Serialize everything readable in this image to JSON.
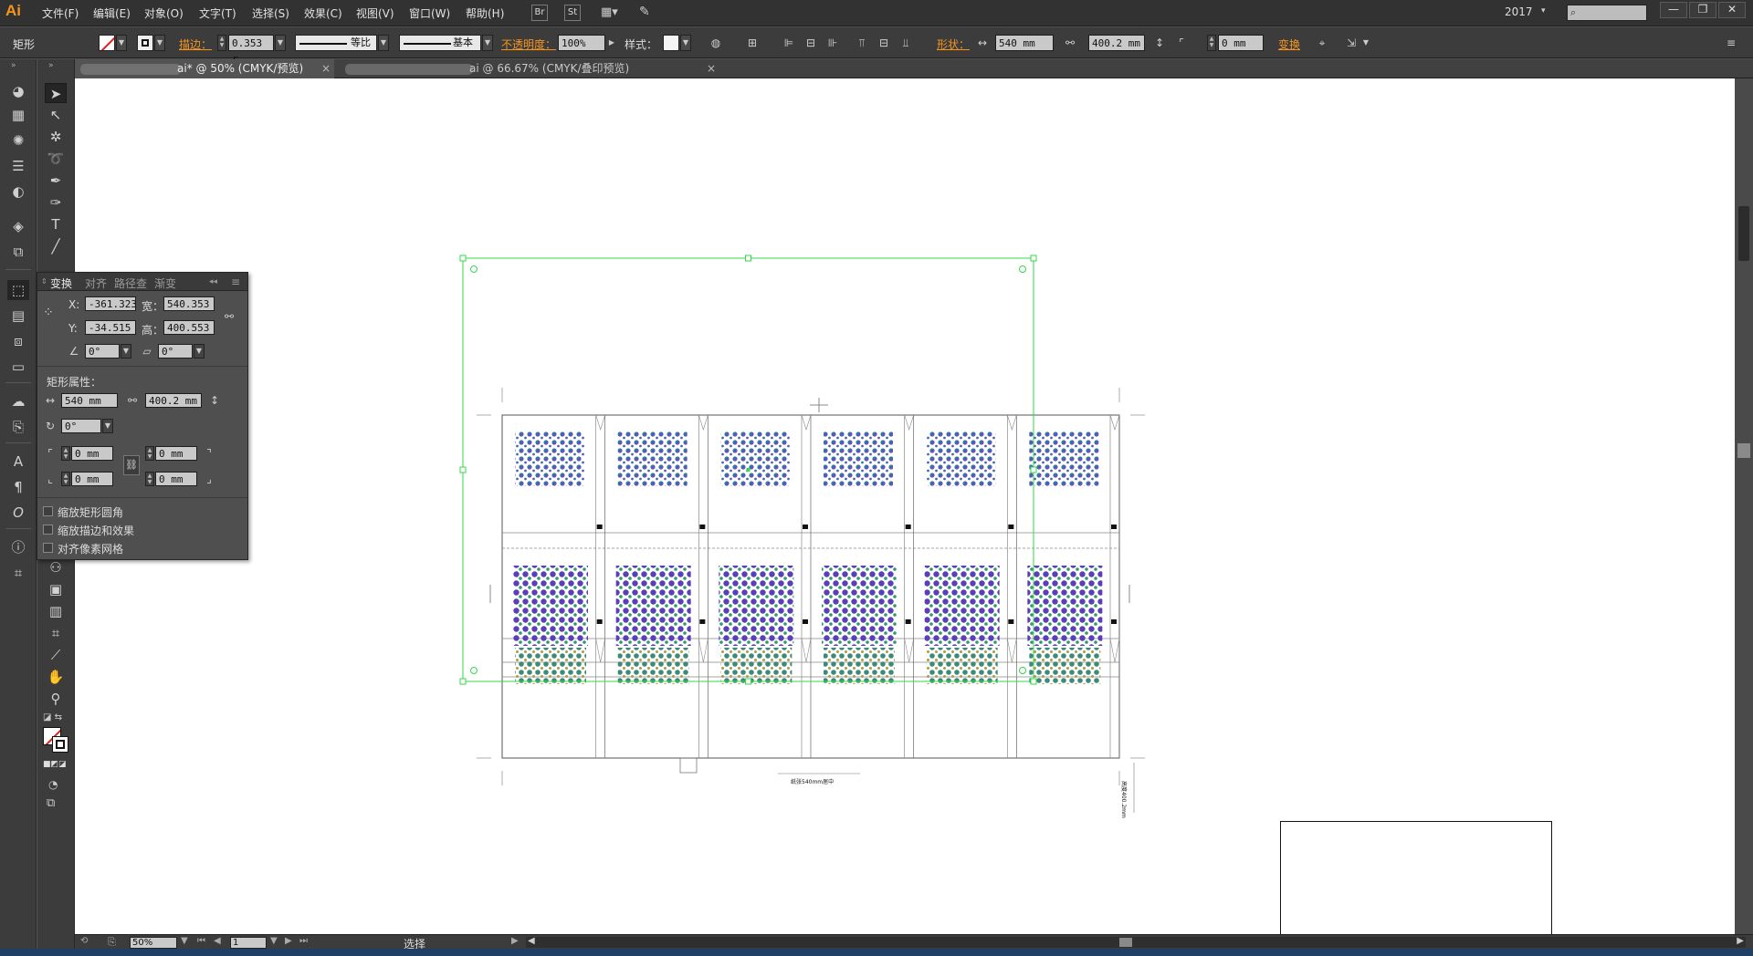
{
  "app": {
    "logo": "Ai",
    "year": "2017"
  },
  "menu": [
    "文件(F)",
    "编辑(E)",
    "对象(O)",
    "文字(T)",
    "选择(S)",
    "效果(C)",
    "视图(V)",
    "窗口(W)",
    "帮助(H)"
  ],
  "menu_buttons": [
    "Br",
    "St"
  ],
  "window_controls": [
    "—",
    "❐",
    "✕"
  ],
  "control_bar": {
    "object_type": "矩形",
    "stroke_label": "描边：",
    "stroke_value": "0.353 r",
    "stroke_profile": "等比",
    "brush": "基本",
    "opacity_label": "不透明度：",
    "opacity_value": "100%",
    "style_label": "样式：",
    "shape_label": "形状：",
    "width": "540 mm",
    "height": "400.2 mm",
    "corner": "0 mm",
    "transform_label": "变换"
  },
  "tabs": [
    {
      "label": "ai* @ 50% (CMYK/预览)",
      "active": true
    },
    {
      "label": "ai @ 66.67% (CMYK/叠印预览)",
      "active": false
    }
  ],
  "transform_panel": {
    "tabs": [
      "变换",
      "对齐",
      "路径查",
      "渐变"
    ],
    "x_label": "X:",
    "x_value": "-361.323",
    "y_label": "Y:",
    "y_value": "-34.515",
    "w_label": "宽：",
    "w_value": "540.353",
    "h_label": "高：",
    "h_value": "400.553",
    "rotate_value": "0°",
    "shear_value": "0°",
    "rect_props_label": "矩形属性：",
    "rect_width": "540 mm",
    "rect_height": "400.2 mm",
    "rect_rotate": "0°",
    "corner_tl": "0 mm",
    "corner_tr": "0 mm",
    "corner_bl": "0 mm",
    "corner_br": "0 mm",
    "options": [
      "缩放矩形圆角",
      "缩放描边和效果",
      "对齐像素网格"
    ]
  },
  "artwork": {
    "bottom_label": "纸张540mm居中",
    "right_label": "高度400.2mm"
  },
  "status_bar": {
    "zoom": "50%",
    "page": "1",
    "tool": "选择"
  },
  "colors": {
    "accent": "#f7941d",
    "selection": "#33d94a"
  }
}
